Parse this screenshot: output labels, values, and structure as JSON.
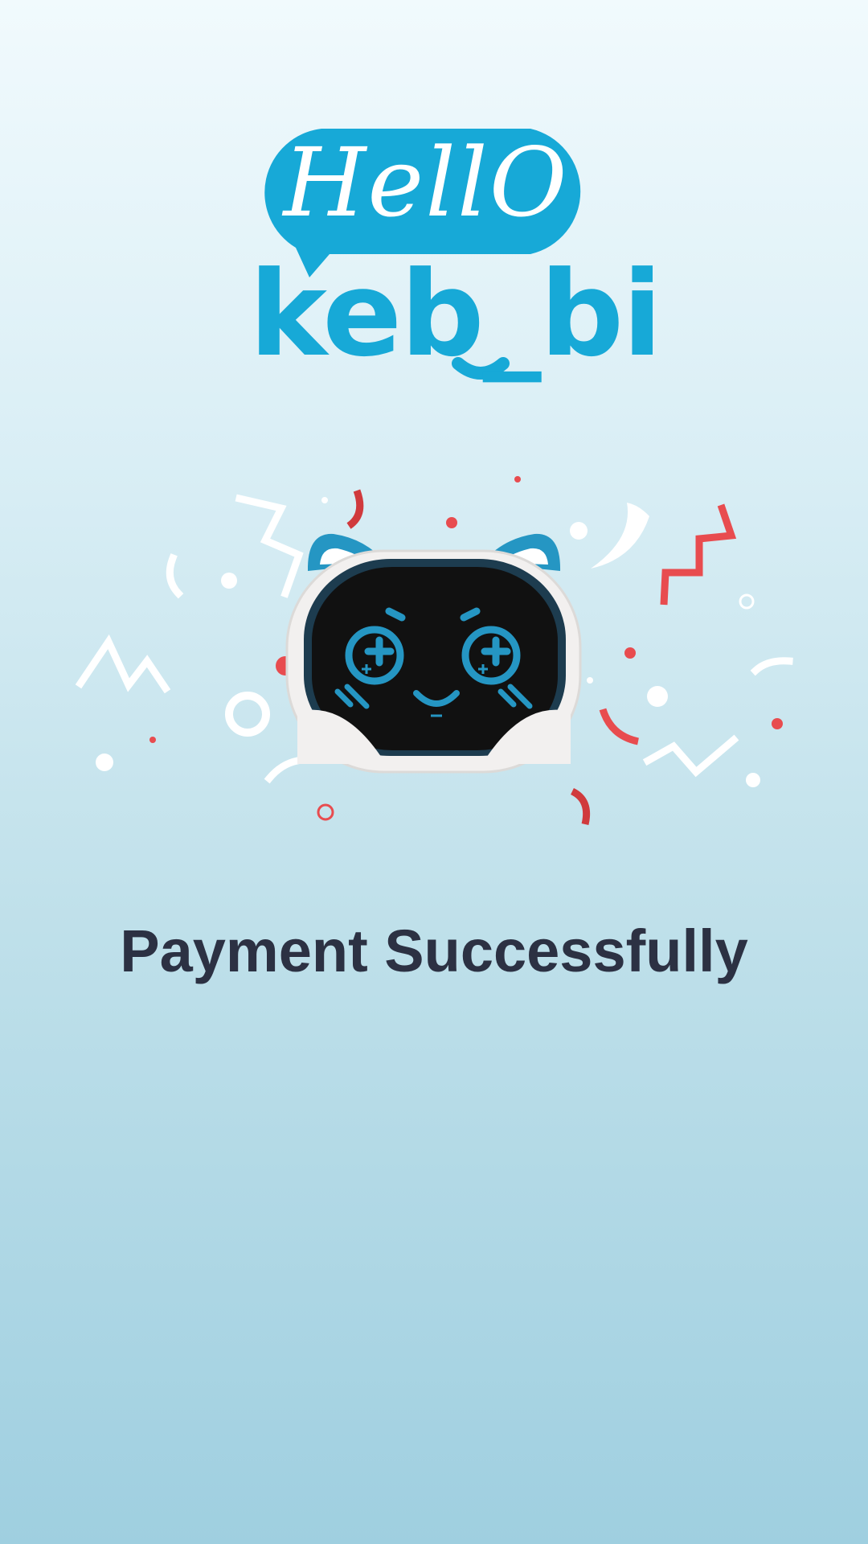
{
  "logo": {
    "greeting": "HellO",
    "brand": "keb_bi",
    "color": "#17a9d7"
  },
  "illustration": {
    "icon": "robot-cat-mascot-icon",
    "confetti_colors": [
      "#ffffff",
      "#e84c4f",
      "#d03a3d"
    ]
  },
  "status": {
    "title": "Payment Successfully"
  }
}
